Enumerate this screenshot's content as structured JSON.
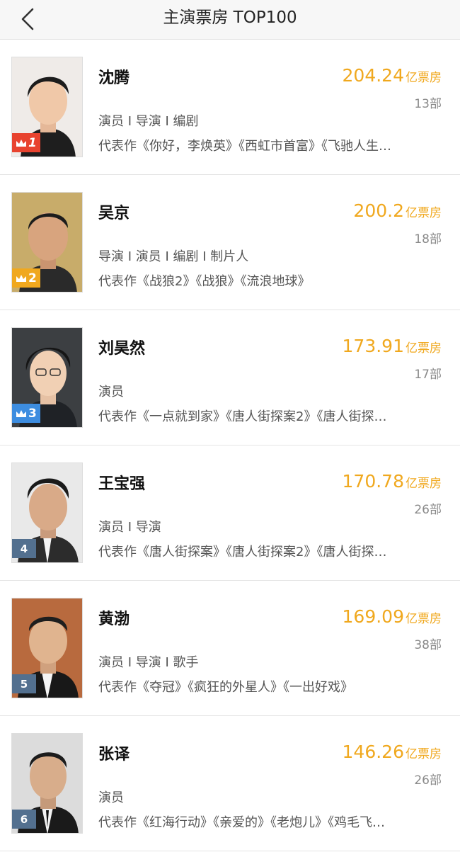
{
  "header": {
    "title": "主演票房 TOP100"
  },
  "gross_unit": "亿票房",
  "colors": {
    "accent": "#f0a81e",
    "rank1": "#e8432f",
    "rank2": "#f0a81e",
    "rank3": "#3d8de0",
    "rank_other": "#53708f"
  },
  "actors": [
    {
      "rank": "1",
      "name": "沈腾",
      "gross": "204.24",
      "films": "13部",
      "roles": "演员 I 导演 I 编剧",
      "works": "代表作《你好，李焕英》《西虹市首富》《飞驰人生…"
    },
    {
      "rank": "2",
      "name": "吴京",
      "gross": "200.2",
      "films": "18部",
      "roles": "导演 I 演员 I 编剧 I 制片人",
      "works": "代表作《战狼2》《战狼》《流浪地球》"
    },
    {
      "rank": "3",
      "name": "刘昊然",
      "gross": "173.91",
      "films": "17部",
      "roles": "演员",
      "works": "代表作《一点就到家》《唐人街探案2》《唐人街探…"
    },
    {
      "rank": "4",
      "name": "王宝强",
      "gross": "170.78",
      "films": "26部",
      "roles": "演员 I 导演",
      "works": "代表作《唐人街探案》《唐人街探案2》《唐人街探…"
    },
    {
      "rank": "5",
      "name": "黄渤",
      "gross": "169.09",
      "films": "38部",
      "roles": "演员 I 导演 I 歌手",
      "works": "代表作《夺冠》《疯狂的外星人》《一出好戏》"
    },
    {
      "rank": "6",
      "name": "张译",
      "gross": "146.26",
      "films": "26部",
      "roles": "演员",
      "works": "代表作《红海行动》《亲爱的》《老炮儿》《鸡毛飞…"
    }
  ]
}
